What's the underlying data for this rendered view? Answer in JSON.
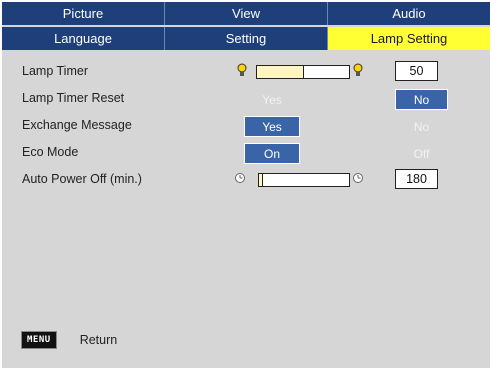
{
  "tabs_row1": [
    "Picture",
    "View",
    "Audio"
  ],
  "tabs_row2": [
    "Language",
    "Setting",
    "Lamp Setting"
  ],
  "active_tab": "Lamp Setting",
  "rows": {
    "lamp_timer": {
      "label": "Lamp Timer",
      "value": "50",
      "level": 0.5
    },
    "lamp_timer_reset": {
      "label": "Lamp Timer Reset",
      "option_a": "Yes",
      "option_b": "No",
      "selected": "No"
    },
    "exchange_message": {
      "label": "Exchange Message",
      "option_a": "Yes",
      "option_b": "No",
      "selected": "Yes"
    },
    "eco_mode": {
      "label": "Eco Mode",
      "option_a": "On",
      "option_b": "Off",
      "selected": "On"
    },
    "auto_power_off": {
      "label": "Auto Power Off (min.)",
      "value": "180",
      "level": 0.03
    }
  },
  "footer": {
    "key": "MENU",
    "action": "Return"
  },
  "colors": {
    "tab_bg": "#1e3f7a",
    "active_tab_bg": "#ffff33",
    "panel_bg": "#d6d6d6",
    "selected_bg": "#3a64a8",
    "slider_fill": "#fff5c0"
  }
}
